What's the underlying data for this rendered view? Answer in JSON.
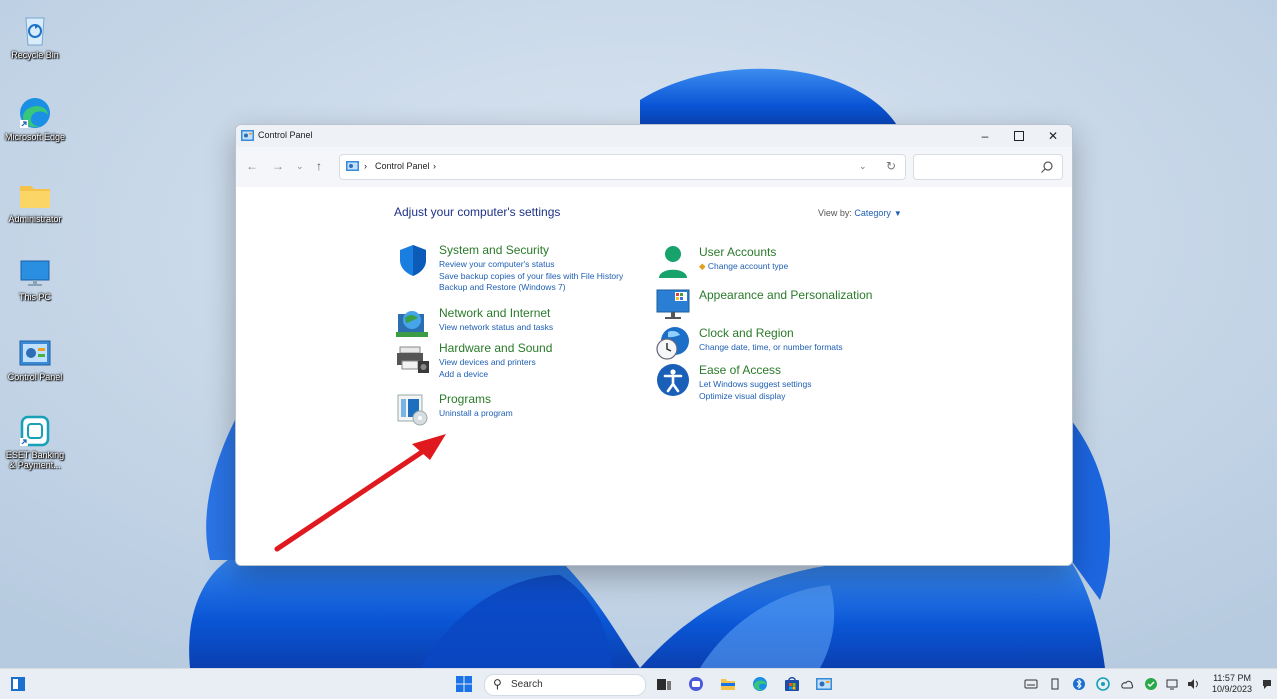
{
  "desktop": {
    "icons": [
      {
        "label": "Recycle Bin",
        "icon": "recycle-bin-icon"
      },
      {
        "label": "Microsoft Edge",
        "icon": "edge-icon"
      },
      {
        "label": "Administrator",
        "icon": "folder-icon"
      },
      {
        "label": "This PC",
        "icon": "monitor-icon"
      },
      {
        "label": "Control Panel",
        "icon": "control-panel-icon"
      },
      {
        "label": "ESET Banking & Payment...",
        "icon": "eset-icon"
      }
    ]
  },
  "window": {
    "title": "Control Panel",
    "controls": {
      "minimize": "–",
      "maximize": "□",
      "close": "✕"
    },
    "nav": {
      "back": "←",
      "forward": "→",
      "recent": "⌄",
      "up": "↑"
    },
    "address": {
      "separator": "›",
      "crumb": "Control Panel",
      "trailing_sep": "›",
      "dropdown": "⌄",
      "refresh": "↻"
    },
    "search": {
      "placeholder": ""
    },
    "heading": "Adjust your computer's settings",
    "view_by": {
      "label": "View by:",
      "value": "Category"
    },
    "categories_left": [
      {
        "title": "System and Security",
        "icon": "shield-icon",
        "links": [
          "Review your computer's status",
          "Save backup copies of your files with File History",
          "Backup and Restore (Windows 7)"
        ]
      },
      {
        "title": "Network and Internet",
        "icon": "network-globe-icon",
        "links": [
          "View network status and tasks"
        ]
      },
      {
        "title": "Hardware and Sound",
        "icon": "printer-icon",
        "links": [
          "View devices and printers",
          "Add a device"
        ]
      },
      {
        "title": "Programs",
        "icon": "programs-icon",
        "links": [
          "Uninstall a program"
        ]
      }
    ],
    "categories_right": [
      {
        "title": "User Accounts",
        "icon": "user-accounts-icon",
        "links": [
          "Change account type"
        ]
      },
      {
        "title": "Appearance and Personalization",
        "icon": "appearance-icon",
        "links": []
      },
      {
        "title": "Clock and Region",
        "icon": "clock-globe-icon",
        "links": [
          "Change date, time, or number formats"
        ]
      },
      {
        "title": "Ease of Access",
        "icon": "ease-of-access-icon",
        "links": [
          "Let Windows suggest settings",
          "Optimize visual display"
        ]
      }
    ]
  },
  "taskbar": {
    "search_label": "Search",
    "time": "11:57 PM",
    "date": "10/9/2023"
  },
  "colors": {
    "accent_link": "#1f5fb3",
    "category_title": "#2a7a2a",
    "heading": "#1e3287",
    "annotation_arrow": "#e0191e"
  }
}
